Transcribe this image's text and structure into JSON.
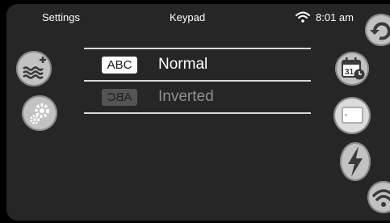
{
  "header": {
    "back_label": "Settings",
    "title": "Keypad",
    "time": "8:01 am"
  },
  "keypad_options": [
    {
      "badge": "ABC",
      "label": "Normal",
      "selected": true
    },
    {
      "badge": "ABC",
      "label": "Inverted",
      "selected": false
    }
  ],
  "side_buttons": {
    "left": [
      "water-temperature-icon",
      "settings-gear-icon"
    ],
    "right": [
      "refresh-icon",
      "calendar-clock-icon",
      "display-icon",
      "power-bolt-icon",
      "wifi-icon"
    ]
  },
  "colors": {
    "background": "#262626",
    "button": "#c2c2c2",
    "icon": "#3a3a3a",
    "accent_text": "#ffffff",
    "dim_text": "#8e8e8e"
  }
}
